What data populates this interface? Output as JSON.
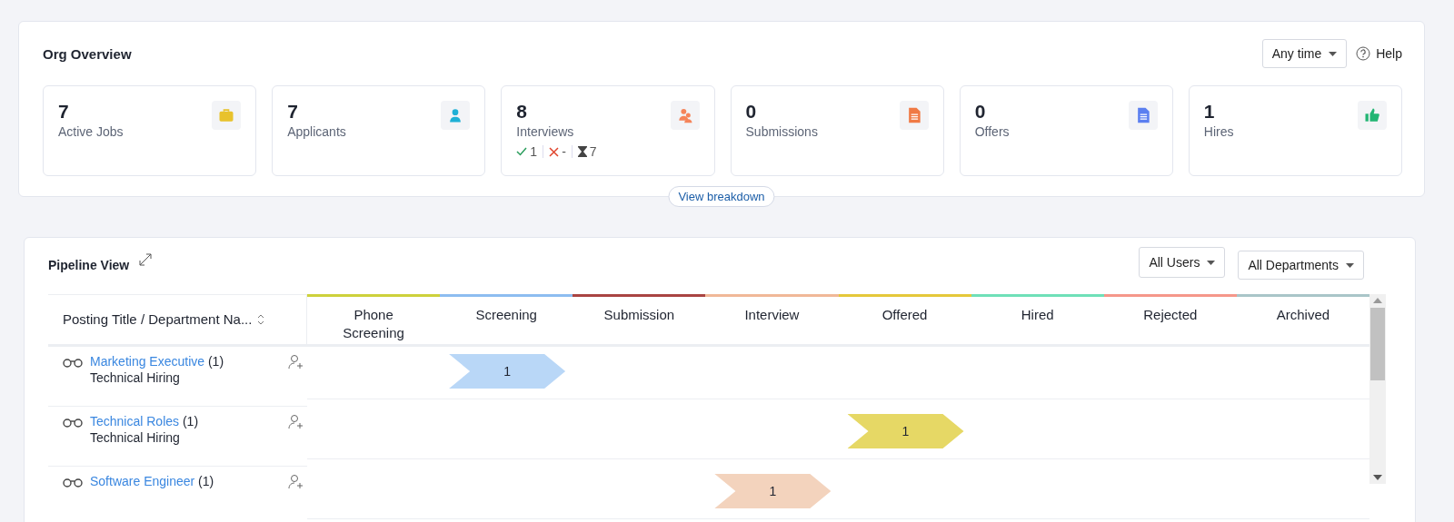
{
  "org_overview": {
    "title": "Org Overview",
    "time_filter": "Any time",
    "help": "Help",
    "stats": [
      {
        "value": "7",
        "label": "Active Jobs",
        "kind": "jobs",
        "color": "#e8c22c"
      },
      {
        "value": "7",
        "label": "Applicants",
        "kind": "applicants",
        "color": "#1fb0d6"
      },
      {
        "value": "8",
        "label": "Interviews",
        "kind": "interviews",
        "color": "#f5845a",
        "breakdown": {
          "passed": "1",
          "failed": "-",
          "pending": "7"
        }
      },
      {
        "value": "0",
        "label": "Submissions",
        "kind": "submissions",
        "color": "#f07a45"
      },
      {
        "value": "0",
        "label": "Offers",
        "kind": "offers",
        "color": "#5b7ff0"
      },
      {
        "value": "1",
        "label": "Hires",
        "kind": "hires",
        "color": "#22b573"
      }
    ],
    "view_breakdown": "View breakdown"
  },
  "pipeline": {
    "title": "Pipeline View",
    "user_filter": "All Users",
    "department_filter": "All Departments",
    "first_column": "Posting Title / Department Na...",
    "columns": [
      {
        "label": "Phone Screening",
        "color": "#cdd13b"
      },
      {
        "label": "Screening",
        "color": "#8dbdf0"
      },
      {
        "label": "Submission",
        "color": "#a94442"
      },
      {
        "label": "Interview",
        "color": "#f0b898"
      },
      {
        "label": "Offered",
        "color": "#e5c83a"
      },
      {
        "label": "Hired",
        "color": "#6fe0b8"
      },
      {
        "label": "Rejected",
        "color": "#f5978a"
      },
      {
        "label": "Archived",
        "color": "#a9c5c8"
      }
    ],
    "rows": [
      {
        "title": "Marketing Executive",
        "count": "(1)",
        "department": "Technical Hiring",
        "cells": [
          null,
          {
            "value": "1",
            "color": "#b9d7f7"
          },
          null,
          null,
          null,
          null,
          null,
          null
        ]
      },
      {
        "title": "Technical Roles",
        "count": "(1)",
        "department": "Technical Hiring",
        "cells": [
          null,
          null,
          null,
          null,
          {
            "value": "1",
            "color": "#e6d865"
          },
          null,
          null,
          null
        ]
      },
      {
        "title": "Software Engineer",
        "count": "(1)",
        "cells": [
          null,
          null,
          null,
          {
            "value": "1",
            "color": "#f3d3bd"
          },
          null,
          null,
          null,
          null
        ]
      }
    ]
  }
}
